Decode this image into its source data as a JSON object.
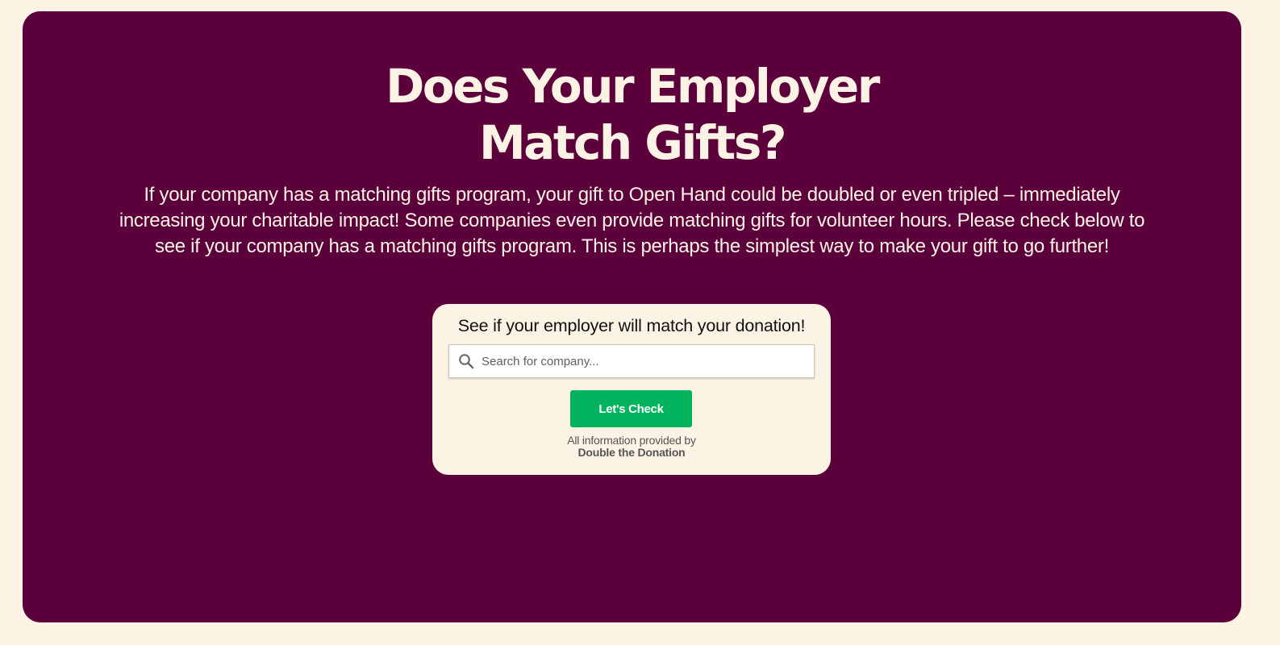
{
  "colors": {
    "page_background": "#fdf3e5",
    "panel_background": "#5b003a",
    "headline_text": "#fdf3e5",
    "button_background": "#00b35c",
    "button_text": "#ffffff"
  },
  "hero": {
    "title_line1": "Does Your Employer",
    "title_line2": "Match Gifts?",
    "description": "If your company has a matching gifts program, your gift to Open Hand could be doubled or even tripled – immediately increasing your charitable impact! Some companies even provide matching gifts for volunteer hours. Please check below to see if your company has a matching gifts program. This is perhaps the simplest way to make your gift to go further!"
  },
  "widget": {
    "title": "See if your employer will match your donation!",
    "search": {
      "icon": "search-icon",
      "placeholder": "Search for company...",
      "value": ""
    },
    "button_label": "Let's Check",
    "attribution_line1": "All information provided by",
    "attribution_brand": "Double the Donation"
  }
}
